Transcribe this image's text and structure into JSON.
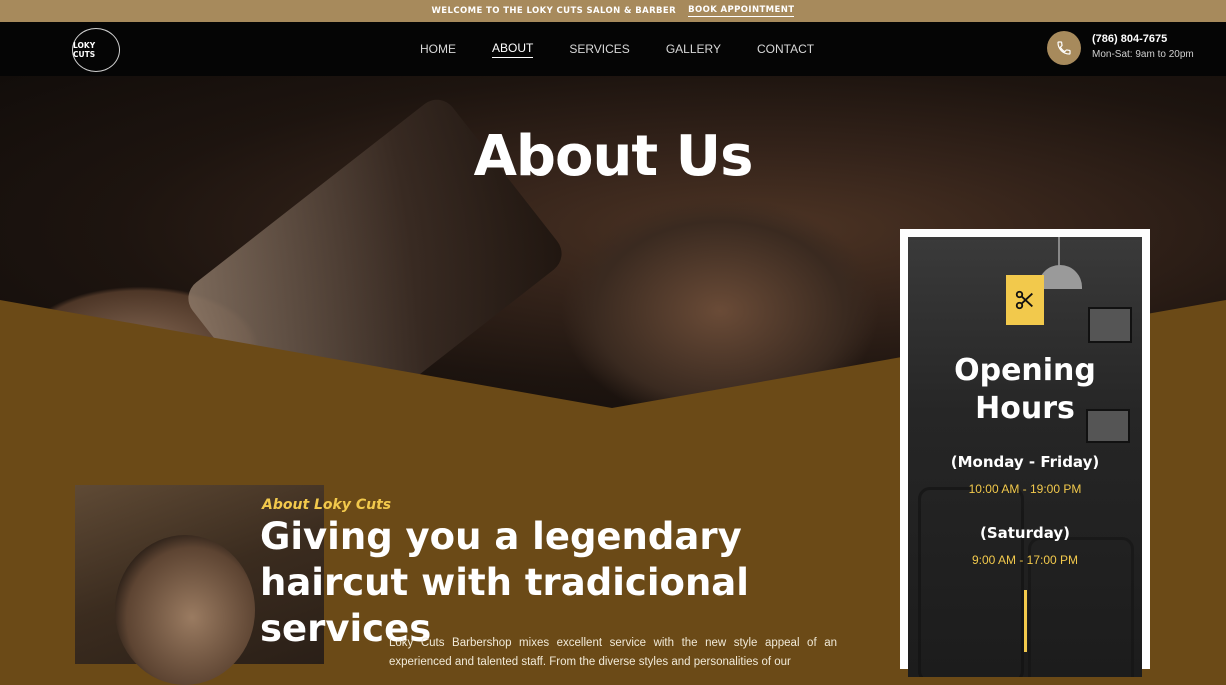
{
  "topbar": {
    "welcome": "WELCOME TO THE LOKY CUTS SALON & BARBER",
    "book": "BOOK APPOINTMENT"
  },
  "nav": {
    "logo": "LOKY CUTS",
    "items": [
      {
        "label": "HOME",
        "active": false
      },
      {
        "label": "ABOUT",
        "active": true
      },
      {
        "label": "SERVICES",
        "active": false
      },
      {
        "label": "GALLERY",
        "active": false
      },
      {
        "label": "CONTACT",
        "active": false
      }
    ],
    "phone": "(786) 804-7675",
    "hours": "Mon-Sat: 9am to 20pm"
  },
  "hero": {
    "title": "About Us"
  },
  "about": {
    "kicker": "About Loky Cuts",
    "headline": "Giving you a legendary haircut with tradicional services",
    "body": "Loky Cuts Barbershop mixes excellent service with the new style appeal of an experienced and talented staff. From the diverse styles and personalities of our"
  },
  "opening": {
    "title": "Opening Hours",
    "weekday_label": "(Monday - Friday)",
    "weekday_time": "10:00 AM - 19:00 PM",
    "saturday_label": "(Saturday)",
    "saturday_time": "9:00 AM - 17:00 PM"
  },
  "colors": {
    "brand_gold": "#a78a5c",
    "accent_yellow": "#f2c94c",
    "section_brown": "#6b4a17",
    "nav_black": "#050505"
  },
  "icons": {
    "phone": "phone-icon",
    "scissors": "scissors-icon"
  }
}
